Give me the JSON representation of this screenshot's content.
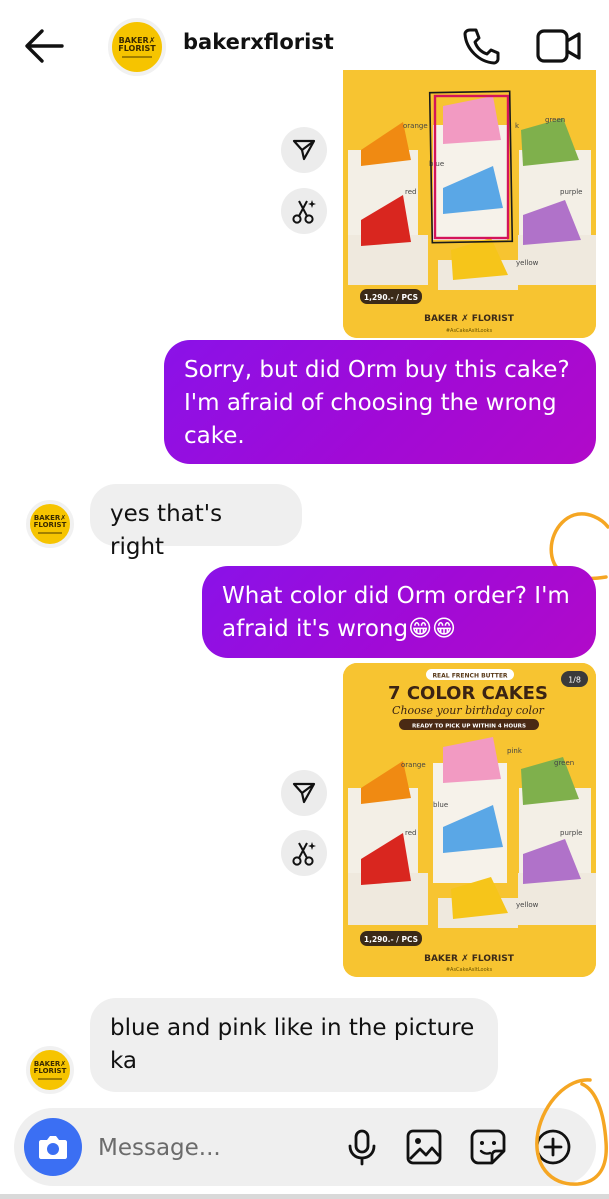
{
  "header": {
    "username": "bakerxflorist",
    "avatar_text": [
      "BAKER✗",
      "FLORIST"
    ]
  },
  "product_card": {
    "tag": "REAL FRENCH BUTTER",
    "title": "7 COLOR CAKES",
    "subtitle": "Choose your birthday color",
    "banner": "READY TO PICK UP WITHIN 4 HOURS",
    "page_counter": "1/8",
    "price": "1,290.- / PCS",
    "brand": "BAKER ✗ FLORIST",
    "hashtag": "#AsCakeAsItLooks",
    "color_labels": [
      "orange",
      "pink",
      "green",
      "blue",
      "red",
      "purple",
      "yellow"
    ],
    "partial_label": "k"
  },
  "messages": [
    {
      "from": "me",
      "text": "Sorry, but did Orm buy this cake? I'm afraid of choosing the wrong cake."
    },
    {
      "from": "them",
      "text": "yes that's right"
    },
    {
      "from": "me",
      "text": "What color did Orm order? I'm afraid it's wrong😁😁"
    },
    {
      "from": "them",
      "text": "blue and pink like in the picture ka"
    }
  ],
  "composer": {
    "placeholder": "Message..."
  },
  "colors": {
    "outgoing_bubble": "#9b0bdc",
    "incoming_bubble": "#efefef",
    "camera_button": "#3b6ff3",
    "annotation_orange": "#f5a623",
    "avatar_yellow": "#f6c400",
    "card_yellow": "#f7c431"
  },
  "icons": [
    "back-arrow-icon",
    "phone-icon",
    "video-icon",
    "share-icon",
    "ai-sparkle-icon",
    "camera-icon",
    "microphone-icon",
    "gallery-icon",
    "sticker-icon",
    "plus-icon"
  ]
}
